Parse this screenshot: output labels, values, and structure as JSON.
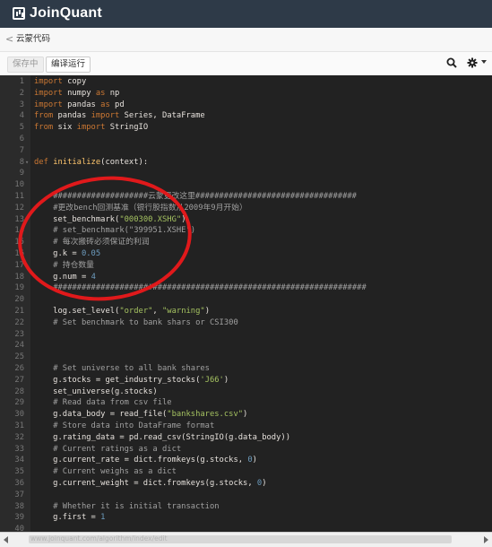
{
  "brand": {
    "name": "JoinQuant"
  },
  "crumb": {
    "back": "<",
    "title": "云蒙代码"
  },
  "toolbar": {
    "save_label": "保存中",
    "compile_label": "编译运行",
    "search_icon": "search-icon",
    "gear_icon": "gear-icon"
  },
  "status": {
    "url": "www.joinquant.com/algorithm/index/edit"
  },
  "editor": {
    "lines": [
      {
        "n": "1",
        "fold": "",
        "code": "import copy"
      },
      {
        "n": "2",
        "fold": "",
        "code": "import numpy as np"
      },
      {
        "n": "3",
        "fold": "",
        "code": "import pandas as pd"
      },
      {
        "n": "4",
        "fold": "",
        "code": "from pandas import Series, DataFrame"
      },
      {
        "n": "5",
        "fold": "",
        "code": "from six import StringIO"
      },
      {
        "n": "6",
        "fold": "",
        "code": ""
      },
      {
        "n": "7",
        "fold": "",
        "code": ""
      },
      {
        "n": "8",
        "fold": "▾",
        "code": "def initialize(context):"
      },
      {
        "n": "9",
        "fold": "",
        "code": ""
      },
      {
        "n": "10",
        "fold": "",
        "code": ""
      },
      {
        "n": "11",
        "fold": "",
        "code": "    ####################云蒙更改这里##################################"
      },
      {
        "n": "12",
        "fold": "",
        "code": "    #更改bench回测基准（银行股指数从2009年9月开始）"
      },
      {
        "n": "13",
        "fold": "",
        "code": "    set_benchmark(\"000300.XSHG\")"
      },
      {
        "n": "14",
        "fold": "",
        "code": "    # set_benchmark(\"399951.XSHE\")"
      },
      {
        "n": "15",
        "fold": "",
        "code": "    # 每次搬砖必须保证的利润"
      },
      {
        "n": "16",
        "fold": "",
        "code": "    g.k = 0.05"
      },
      {
        "n": "17",
        "fold": "",
        "code": "    # 持仓数量"
      },
      {
        "n": "18",
        "fold": "",
        "code": "    g.num = 4"
      },
      {
        "n": "19",
        "fold": "",
        "code": "    ##################################################################"
      },
      {
        "n": "20",
        "fold": "",
        "code": ""
      },
      {
        "n": "21",
        "fold": "",
        "code": "    log.set_level(\"order\", \"warning\")"
      },
      {
        "n": "22",
        "fold": "",
        "code": "    # Set benchmark to bank shars or CSI300"
      },
      {
        "n": "23",
        "fold": "",
        "code": ""
      },
      {
        "n": "24",
        "fold": "",
        "code": ""
      },
      {
        "n": "25",
        "fold": "",
        "code": ""
      },
      {
        "n": "26",
        "fold": "",
        "code": "    # Set universe to all bank shares"
      },
      {
        "n": "27",
        "fold": "",
        "code": "    g.stocks = get_industry_stocks('J66')"
      },
      {
        "n": "28",
        "fold": "",
        "code": "    set_universe(g.stocks)"
      },
      {
        "n": "29",
        "fold": "",
        "code": "    # Read data from csv file"
      },
      {
        "n": "30",
        "fold": "",
        "code": "    g.data_body = read_file(\"bankshares.csv\")"
      },
      {
        "n": "31",
        "fold": "",
        "code": "    # Store data into DataFrame format"
      },
      {
        "n": "32",
        "fold": "",
        "code": "    g.rating_data = pd.read_csv(StringIO(g.data_body))"
      },
      {
        "n": "33",
        "fold": "",
        "code": "    # Current ratings as a dict"
      },
      {
        "n": "34",
        "fold": "",
        "code": "    g.current_rate = dict.fromkeys(g.stocks, 0)"
      },
      {
        "n": "35",
        "fold": "",
        "code": "    # Current weighs as a dict"
      },
      {
        "n": "36",
        "fold": "",
        "code": "    g.current_weight = dict.fromkeys(g.stocks, 0)"
      },
      {
        "n": "37",
        "fold": "",
        "code": ""
      },
      {
        "n": "38",
        "fold": "",
        "code": "    # Whether it is initial transaction"
      },
      {
        "n": "39",
        "fold": "",
        "code": "    g.first = 1"
      },
      {
        "n": "40",
        "fold": "",
        "code": ""
      }
    ]
  },
  "colors": {
    "topbar": "#2e3a48",
    "editor_bg": "#222222",
    "annotation_circle": "#e0191b"
  }
}
